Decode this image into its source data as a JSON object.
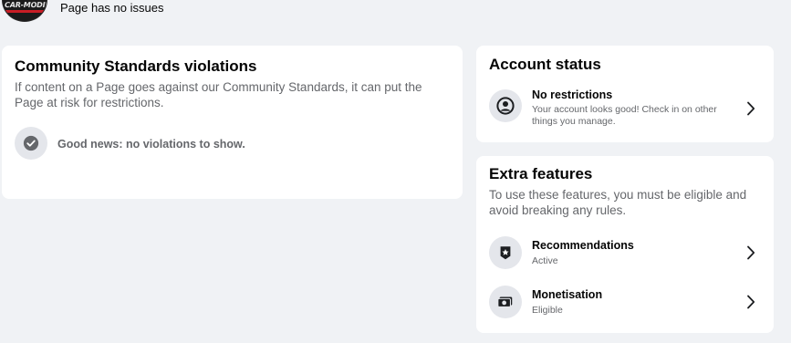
{
  "header": {
    "avatar_text": "CAR-MODIFY",
    "status_text": "Page has no issues"
  },
  "community": {
    "title": "Community Standards violations",
    "description": "If content on a Page goes against our Community Standards, it can put the Page at risk for restrictions.",
    "good_news": "Good news: no violations to show."
  },
  "account": {
    "title": "Account status",
    "row_title": "No restrictions",
    "row_subtitle": "Your account looks good! Check in on other things you manage."
  },
  "extra": {
    "title": "Extra features",
    "description": "To use these features, you must be eligible and avoid breaking any rules.",
    "items": [
      {
        "label": "Recommendations",
        "status": "Active"
      },
      {
        "label": "Monetisation",
        "status": "Eligible"
      }
    ]
  },
  "colors": {
    "background": "#f0f2f5",
    "card": "#ffffff",
    "secondary_text": "#65676b",
    "icon_bg": "#e4e6eb",
    "status_green": "#31a24c"
  }
}
